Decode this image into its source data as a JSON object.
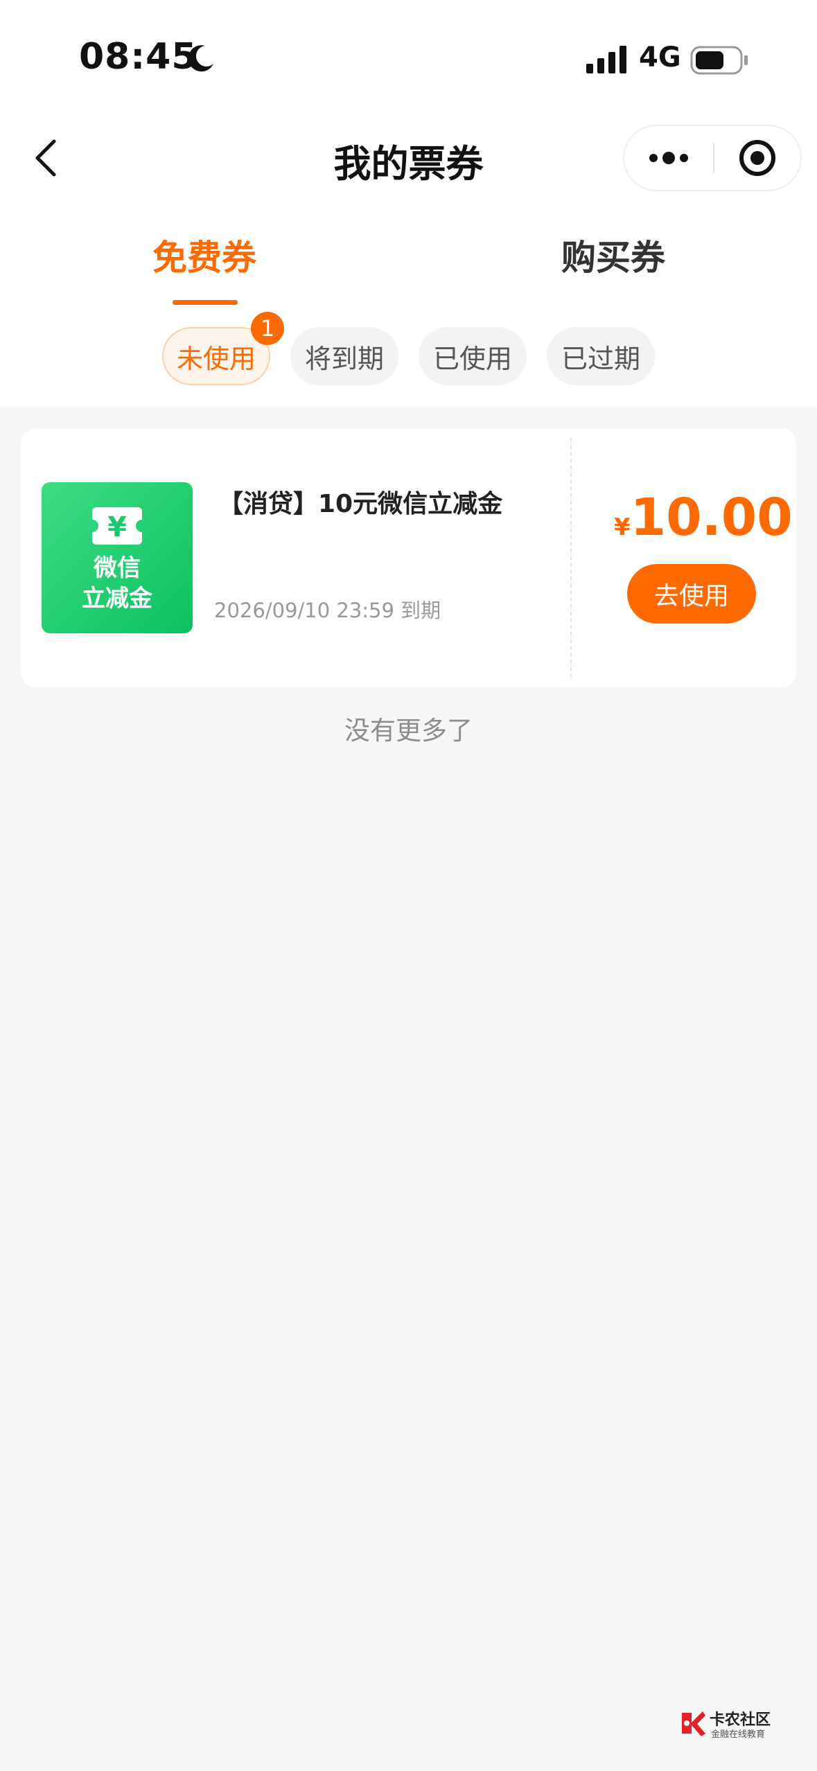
{
  "status_bar": {
    "time": "08:45",
    "network": "4G",
    "icons": [
      "moon-icon",
      "signal-icon",
      "battery-icon"
    ]
  },
  "nav": {
    "title": "我的票券",
    "back_icon": "chevron-left-icon",
    "more_icon": "more-dots-icon",
    "close_icon": "target-close-icon"
  },
  "tabs": [
    {
      "label": "免费券",
      "active": true
    },
    {
      "label": "购买券",
      "active": false
    }
  ],
  "filters": [
    {
      "label": "未使用",
      "active": true,
      "badge": "1"
    },
    {
      "label": "将到期",
      "active": false
    },
    {
      "label": "已使用",
      "active": false
    },
    {
      "label": "已过期",
      "active": false
    }
  ],
  "coupon": {
    "icon_text": "微信\n立减金",
    "icon_glyph": "¥",
    "name": "【消贷】10元微信立减金",
    "expiry": "2026/09/10 23:59 到期",
    "currency": "¥",
    "amount": "10.00",
    "button": "去使用"
  },
  "footer_text": "没有更多了",
  "watermark": {
    "title": "卡农社区",
    "subtitle": "金融在线教育"
  },
  "colors": {
    "accent": "#ff6a00",
    "coupon_green": "#07c160",
    "background": "#f6f6f6"
  }
}
